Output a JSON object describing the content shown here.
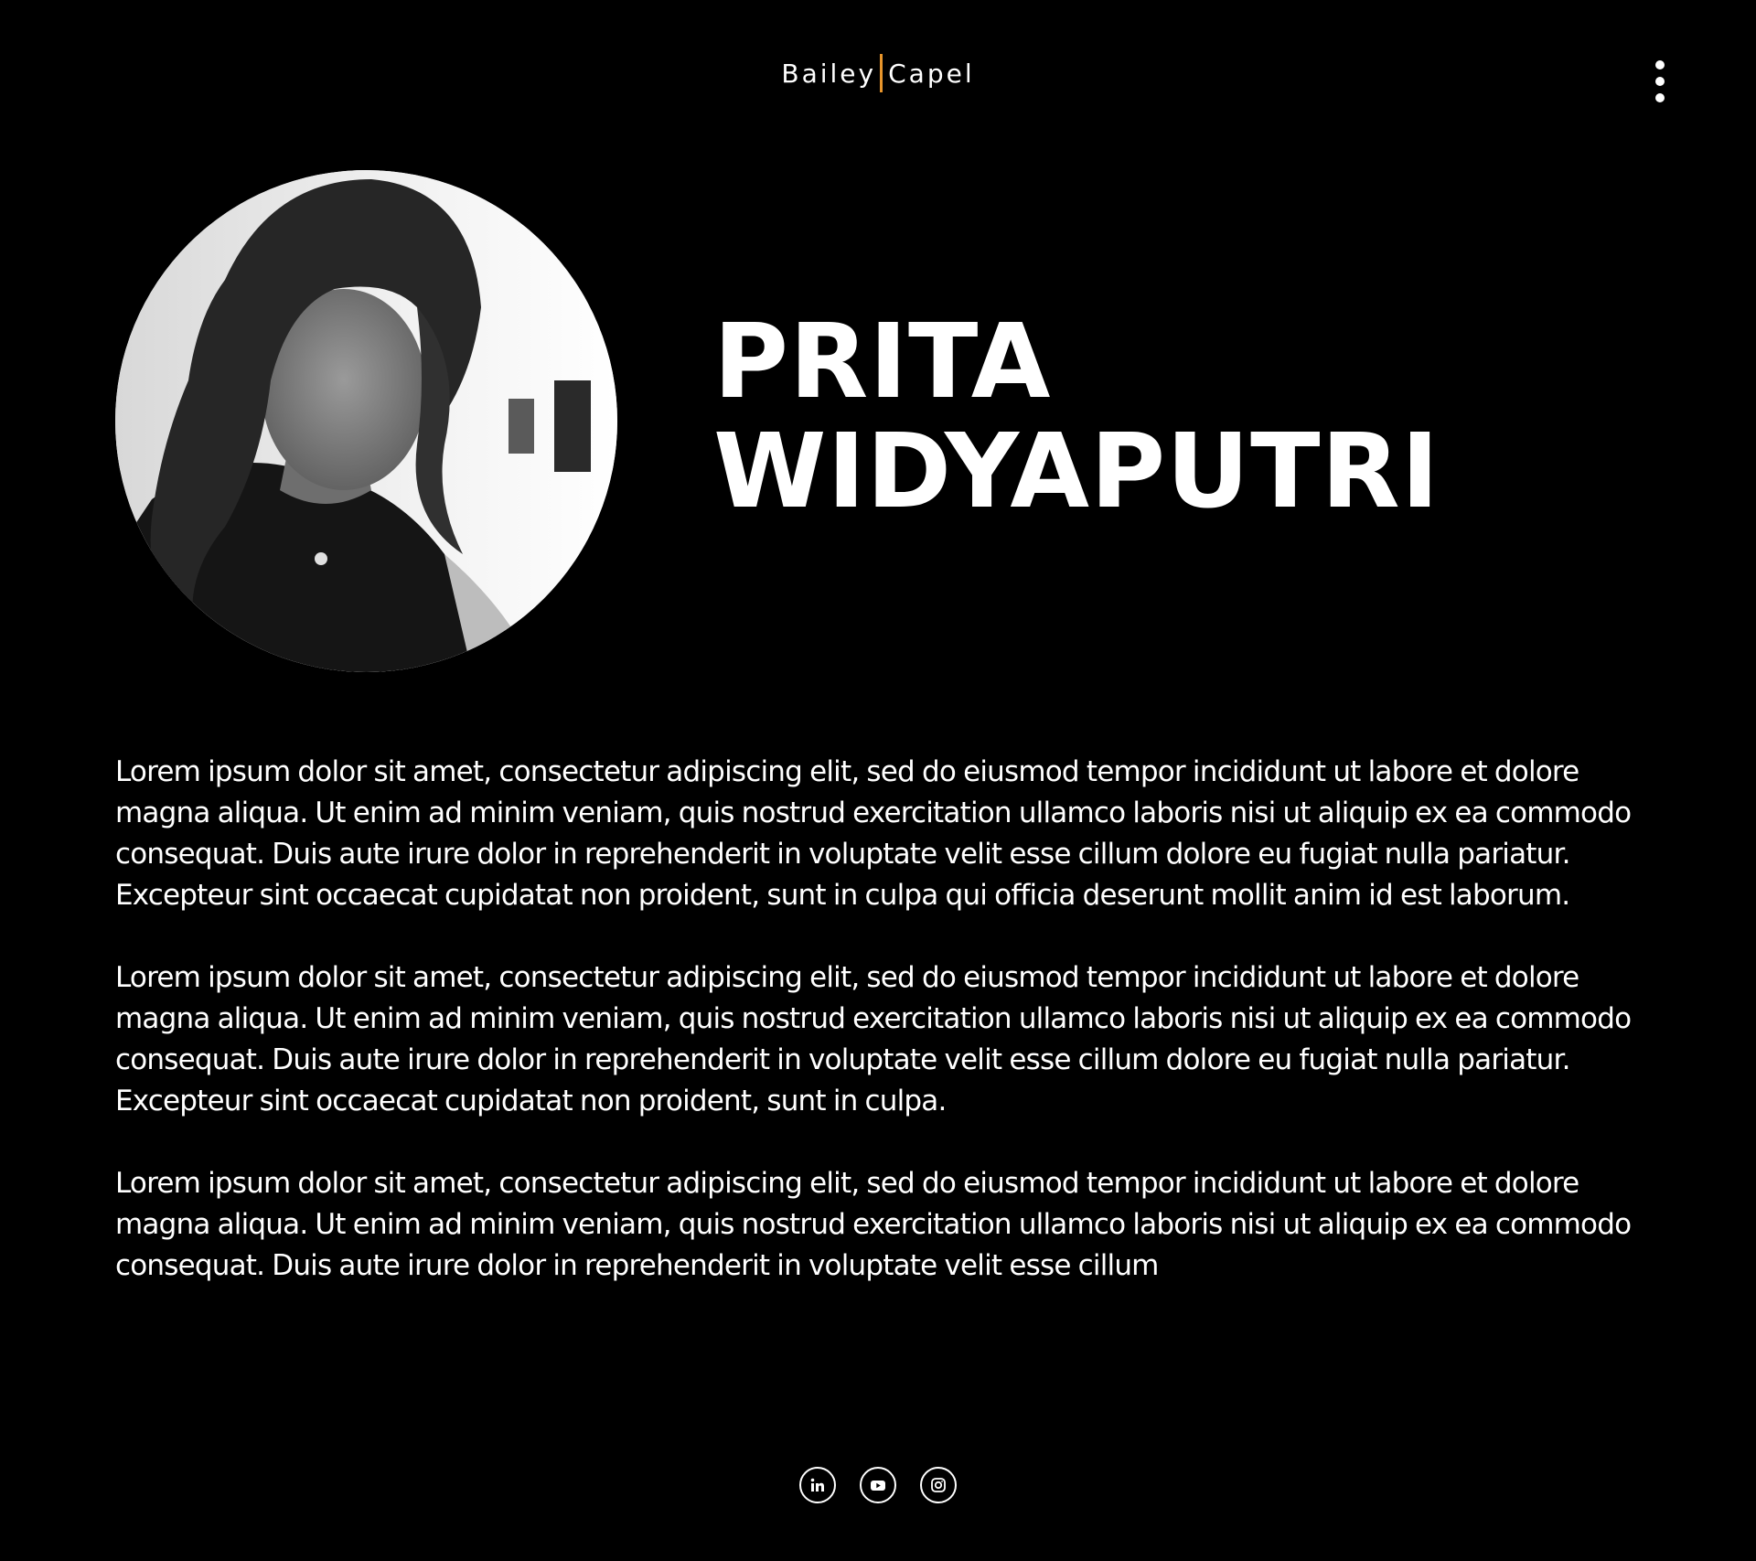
{
  "header": {
    "logo_left": "Bailey",
    "logo_right": "Capel",
    "accent_color": "#e8952b",
    "menu_icon": "kebab-menu-icon"
  },
  "profile": {
    "first_name": "PRITA",
    "last_name": "WIDYAPUTRI",
    "portrait_icon": "portrait-photo"
  },
  "bio": {
    "paragraphs": [
      "Lorem ipsum dolor sit amet, consectetur adipiscing elit, sed do eiusmod tempor incididunt ut labore et dolore magna aliqua. Ut enim ad minim veniam, quis nostrud exercitation ullamco laboris nisi ut aliquip ex ea commodo consequat. Duis aute irure dolor in reprehenderit in voluptate velit esse cillum dolore eu fugiat nulla pariatur. Excepteur sint occaecat cupidatat non proident, sunt in culpa qui officia deserunt mollit anim id est laborum.",
      "Lorem ipsum dolor sit amet, consectetur adipiscing elit, sed do eiusmod tempor incididunt ut labore et dolore magna aliqua. Ut enim ad minim veniam, quis nostrud exercitation ullamco laboris nisi ut aliquip ex ea commodo consequat. Duis aute irure dolor in reprehenderit in voluptate velit esse cillum dolore eu fugiat nulla pariatur. Excepteur sint occaecat cupidatat non proident, sunt in culpa.",
      "Lorem ipsum dolor sit amet, consectetur adipiscing elit, sed do eiusmod tempor incididunt ut labore et dolore magna aliqua. Ut enim ad minim veniam, quis nostrud exercitation ullamco laboris nisi ut aliquip ex ea commodo consequat. Duis aute irure dolor in reprehenderit in voluptate velit esse cillum"
    ]
  },
  "social": {
    "icons": [
      "linkedin-icon",
      "youtube-icon",
      "instagram-icon"
    ]
  },
  "colors": {
    "background": "#000000",
    "text": "#ffffff"
  }
}
